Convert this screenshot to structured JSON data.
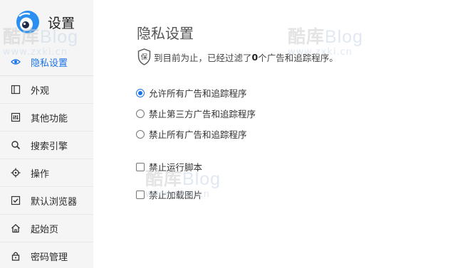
{
  "app": {
    "title": "设置"
  },
  "sidebar": {
    "items": [
      {
        "label": "隐私设置",
        "icon": "eye-icon",
        "active": true
      },
      {
        "label": "外观",
        "icon": "layout-icon",
        "active": false
      },
      {
        "label": "其他功能",
        "icon": "sliders-icon",
        "active": false
      },
      {
        "label": "搜索引擎",
        "icon": "search-icon",
        "active": false
      },
      {
        "label": "操作",
        "icon": "crosshair-icon",
        "active": false
      },
      {
        "label": "默认浏览器",
        "icon": "checkbox-icon",
        "active": false
      },
      {
        "label": "起始页",
        "icon": "home-icon",
        "active": false
      },
      {
        "label": "密码管理",
        "icon": "lock-icon",
        "active": false
      }
    ]
  },
  "main": {
    "title": "隐私设置",
    "stat": {
      "shield_char": "保",
      "prefix": "到目前为止，已经过滤了",
      "count": "0",
      "suffix": "个广告和追踪程序。"
    },
    "radio_options": [
      {
        "label": "允许所有广告和追踪程序",
        "selected": true
      },
      {
        "label": "禁止第三方广告和追踪程序",
        "selected": false
      },
      {
        "label": "禁止所有广告和追踪程序",
        "selected": false
      }
    ],
    "checkbox_options": [
      {
        "label": "禁止运行脚本",
        "checked": false
      },
      {
        "label": "禁止加载图片",
        "checked": false
      }
    ]
  },
  "watermark": {
    "cn": "酷库",
    "blog": "Blog",
    "url": "www.zxki.cn"
  },
  "colors": {
    "accent": "#1a73e8",
    "sidebar_bg": "#f5f5f5"
  }
}
